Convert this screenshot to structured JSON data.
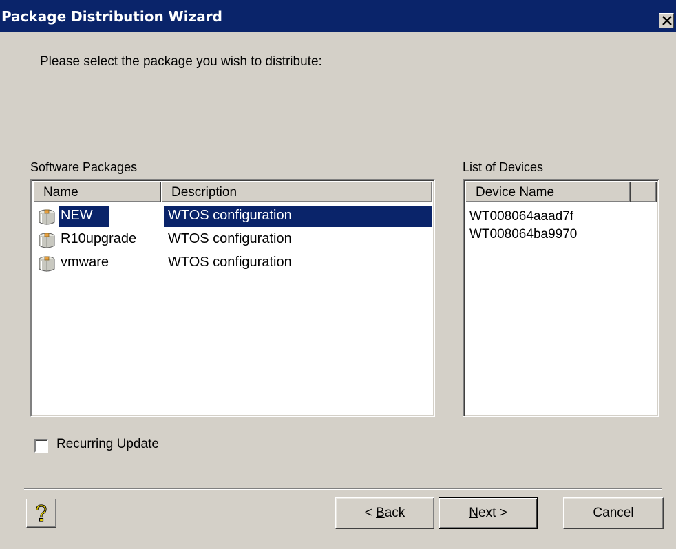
{
  "window": {
    "title": "Package Distribution Wizard",
    "close_icon": "close-x-icon"
  },
  "prompt": "Please select the package you wish to distribute:",
  "packages": {
    "label": "Software Packages",
    "columns": [
      "Name",
      "Description"
    ],
    "rows": [
      {
        "name": "NEW",
        "description": "WTOS configuration",
        "icon": "package-icon",
        "selected": true
      },
      {
        "name": "R10upgrade",
        "description": "WTOS configuration",
        "icon": "package-icon",
        "selected": false
      },
      {
        "name": "vmware",
        "description": "WTOS configuration",
        "icon": "package-icon",
        "selected": false
      }
    ]
  },
  "devices": {
    "label": "List of Devices",
    "columns": [
      "Device Name",
      ""
    ],
    "rows": [
      "WT008064aaad7f",
      "WT008064ba9970"
    ]
  },
  "recurring": {
    "label": "Recurring Update",
    "checked": false
  },
  "buttons": {
    "help_icon": "help-question-icon",
    "back_prefix": "< ",
    "back_mnemonic": "B",
    "back_rest": "ack",
    "next_mnemonic": "N",
    "next_rest": "ext >",
    "cancel": "Cancel"
  },
  "colors": {
    "titlebar": "#0a246a",
    "dialog_bg": "#d4d0c8",
    "selection": "#0a246a"
  }
}
